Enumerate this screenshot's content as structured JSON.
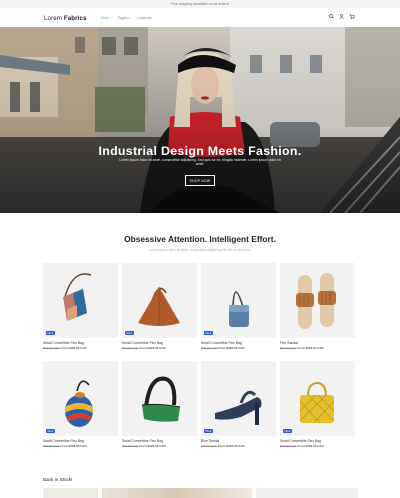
{
  "announcement": "Free shipping available on all orders!",
  "brand": {
    "prefix": "Lorem ",
    "name": "Fabrics"
  },
  "nav": {
    "items": [
      {
        "label": "Shop",
        "has_caret": true
      },
      {
        "label": "Pages",
        "has_caret": true
      },
      {
        "label": "Lookbook",
        "has_caret": false
      }
    ],
    "icons": [
      "search-icon",
      "user-icon",
      "cart-icon"
    ]
  },
  "hero": {
    "title": "Industrial Design Meets Fashion.",
    "subtitle": "Lorem ipsum dolor sit amet, consectetur adipiscing. Sed quis tur ex, fringilla molestie. Lorem ipsum dolor sit amet.",
    "button": "SHOP NOW"
  },
  "section": {
    "title": "Obsessive Attention. Intelligent Effort.",
    "subtitle": "Lorem ipsum dolor sit amet, consectetur adipiscing elit sed do eiusmod."
  },
  "products": [
    {
      "name": "Small Convertible Flex Bag",
      "old_price": "$99.00 CAD",
      "price_label": "From $323.30 CAD",
      "badge": "SALE",
      "icon": "crossbody-bag-icon"
    },
    {
      "name": "Small Convertible Flex Bag",
      "old_price": "$99.00 CAD",
      "price_label": "From $323.30 CAD",
      "badge": "SALE",
      "icon": "triangle-bag-icon"
    },
    {
      "name": "Small Convertible Flex Bag",
      "old_price": "$99.00 CAD",
      "price_label": "From $323.30 CAD",
      "badge": "SALE",
      "icon": "mini-bag-icon"
    },
    {
      "name": "Flex Sandal",
      "old_price": "$99.00 CAD",
      "price_label": "From $323.30 CAD",
      "badge": "",
      "icon": "slide-sandal-icon"
    },
    {
      "name": "Small Convertible Flex Bag",
      "old_price": "$99.00 CAD",
      "price_label": "From $323.30 CAD",
      "badge": "SALE",
      "icon": "bucket-bag-icon"
    },
    {
      "name": "Small Convertible Flex Bag",
      "old_price": "$99.00 CAD",
      "price_label": "From $323.30 CAD",
      "badge": "",
      "icon": "shoulder-bag-icon"
    },
    {
      "name": "Blue Sandal",
      "old_price": "$99.00 CAD",
      "price_label": "From $323.30 CAD",
      "badge": "SALE",
      "icon": "heel-sandal-icon"
    },
    {
      "name": "Small Convertible Flex Bag",
      "old_price": "$99.00 CAD",
      "price_label": "From $323.30 CAD",
      "badge": "SALE",
      "icon": "quilted-bag-icon"
    }
  ],
  "back_in_stock": {
    "title": "Back In Stock!"
  },
  "colors": {
    "badge": "#2b56d9",
    "accent": "#d2232a"
  }
}
